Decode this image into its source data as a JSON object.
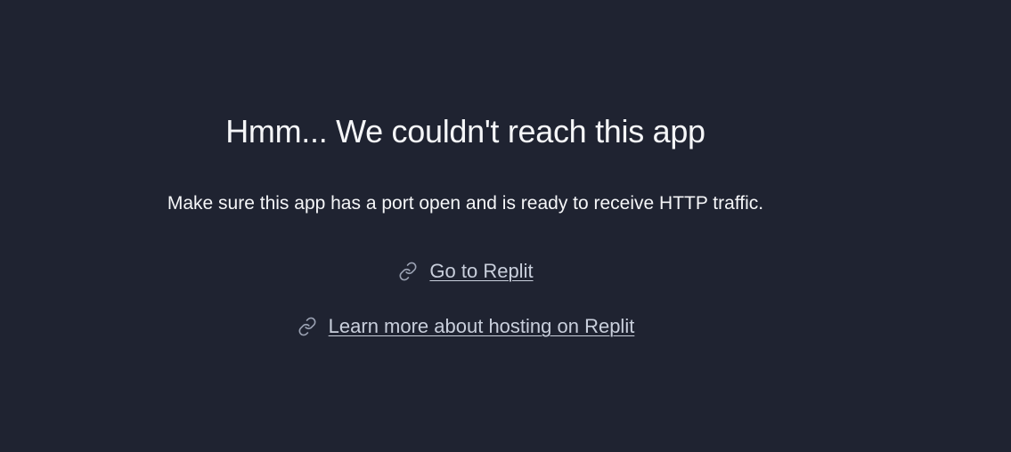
{
  "error": {
    "title": "Hmm... We couldn't reach this app",
    "message": "Make sure this app has a port open and is ready to receive HTTP traffic."
  },
  "links": [
    {
      "label": "Go to Replit",
      "icon": "link-icon"
    },
    {
      "label": "Learn more about hosting on Replit",
      "icon": "link-icon"
    }
  ],
  "colors": {
    "background": "#1f2331",
    "text": "#f5f6f8",
    "link": "#c9cfdc",
    "icon": "#9aa1b2"
  }
}
